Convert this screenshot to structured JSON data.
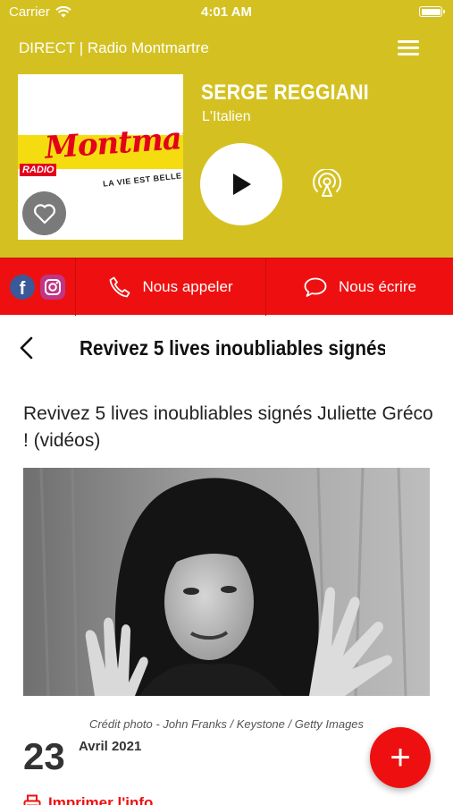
{
  "status_bar": {
    "carrier": "Carrier",
    "time": "4:01 AM"
  },
  "header": {
    "title": "DIRECT | Radio Montmartre"
  },
  "player": {
    "logo": {
      "script_text": "Montmartre",
      "radio_text": "RADIO",
      "slogan": "LA VIE EST BELLE"
    },
    "artist": "SERGE REGGIANI",
    "song": "L'Italien"
  },
  "contact_bar": {
    "call_label": "Nous appeler",
    "write_label": "Nous écrire"
  },
  "article_nav": {
    "title": "Revivez 5 lives inoubliables signés ..."
  },
  "article": {
    "title": "Revivez 5 lives inoubliables signés Juliette Gréco ! (vidéos)",
    "photo_credit": "Crédit photo - John Franks / Keystone / Getty Images",
    "date_day": "23",
    "date_month_year": "Avril 2021",
    "print_label": "Imprimer l'info"
  },
  "fab": {
    "label": "+"
  },
  "colors": {
    "brand_yellow": "#d4c121",
    "brand_red": "#ee1010"
  }
}
